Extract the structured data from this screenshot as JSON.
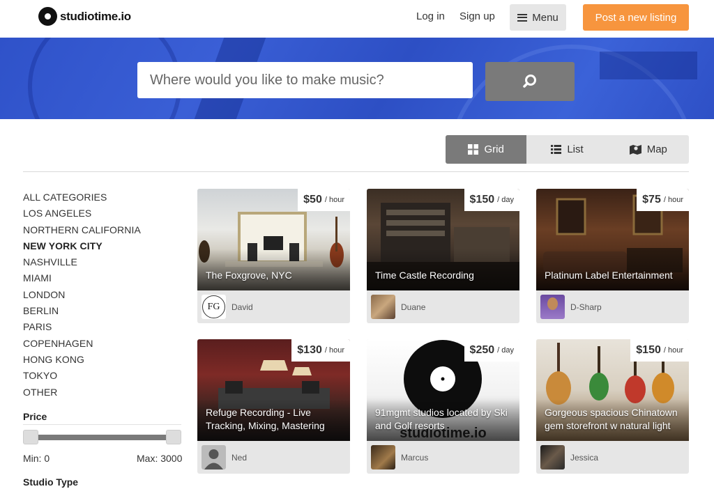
{
  "header": {
    "logo_text": "studiotime.io",
    "login": "Log in",
    "signup": "Sign up",
    "menu": "Menu",
    "post": "Post a new listing"
  },
  "search": {
    "placeholder": "Where would you like to make music?"
  },
  "views": {
    "grid": "Grid",
    "list": "List",
    "map": "Map",
    "active": "Grid"
  },
  "sidebar": {
    "categories": [
      {
        "label": "ALL CATEGORIES"
      },
      {
        "label": "LOS ANGELES"
      },
      {
        "label": "NORTHERN CALIFORNIA"
      },
      {
        "label": "NEW YORK CITY",
        "active": true
      },
      {
        "label": "NASHVILLE"
      },
      {
        "label": "MIAMI"
      },
      {
        "label": "LONDON"
      },
      {
        "label": "BERLIN"
      },
      {
        "label": "PARIS"
      },
      {
        "label": "COPENHAGEN"
      },
      {
        "label": "HONG KONG"
      },
      {
        "label": "TOKYO"
      },
      {
        "label": "OTHER"
      }
    ],
    "price_label": "Price",
    "price_min": "Min: 0",
    "price_max": "Max: 3000",
    "studio_type_label": "Studio Type"
  },
  "listings": [
    {
      "title": "The Foxgrove, NYC",
      "price": "$50",
      "unit": "/ hour",
      "owner": "David"
    },
    {
      "title": "Time Castle Recording",
      "price": "$150",
      "unit": "/ day",
      "owner": "Duane"
    },
    {
      "title": "Platinum Label Entertainment",
      "price": "$75",
      "unit": "/ hour",
      "owner": "D-Sharp"
    },
    {
      "title": "Refuge Recording - Live Tracking, Mixing, Mastering",
      "price": "$130",
      "unit": "/ hour",
      "owner": "Ned"
    },
    {
      "title": "91mgmt studios located by Ski and Golf resorts",
      "price": "$250",
      "unit": "/ day",
      "owner": "Marcus",
      "watermark": "studiotime.io"
    },
    {
      "title": "Gorgeous spacious Chinatown gem storefront w natural light",
      "price": "$150",
      "unit": "/ hour",
      "owner": "Jessica"
    }
  ],
  "avatar_initials": {
    "fg": "FG"
  },
  "colors": {
    "accent": "#f7953e",
    "hero": "#2f52c9",
    "toggle_active": "#7a7a7a"
  }
}
